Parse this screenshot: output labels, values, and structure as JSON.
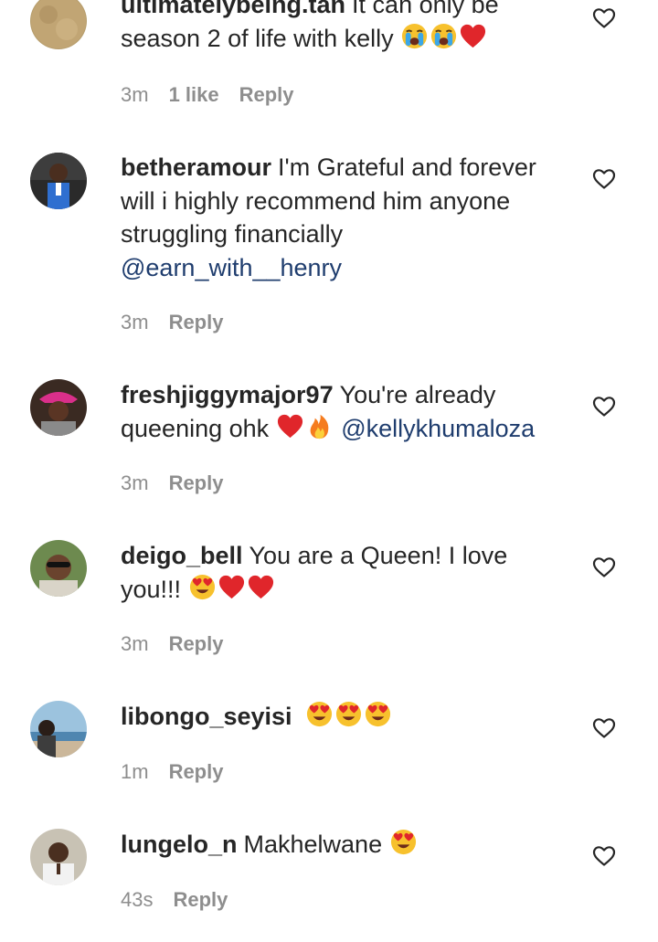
{
  "comments": [
    {
      "username": "ultimatelybeing.tan",
      "text": "It can only be season 2 of life with kelly",
      "emojis": [
        "crying-face",
        "crying-face",
        "red-heart"
      ],
      "time": "3m",
      "likes": "1 like",
      "reply": "Reply"
    },
    {
      "username": "betheramour",
      "text": "I'm Grateful and forever will i highly recommend him anyone struggling financially",
      "mention": "@earn_with__henry",
      "time": "3m",
      "reply": "Reply"
    },
    {
      "username": "freshjiggymajor97",
      "text": "You're already queening ohk",
      "emojis": [
        "red-heart",
        "fire"
      ],
      "mention": "@kellykhumaloza",
      "time": "3m",
      "reply": "Reply"
    },
    {
      "username": "deigo_bell",
      "text": "You are a Queen! I love you!!!",
      "emojis": [
        "heart-eyes-face",
        "red-heart",
        "red-heart"
      ],
      "time": "3m",
      "reply": "Reply"
    },
    {
      "username": "libongo_seyisi",
      "text": "",
      "emojis": [
        "heart-eyes-face",
        "heart-eyes-face",
        "heart-eyes-face"
      ],
      "time": "1m",
      "reply": "Reply"
    },
    {
      "username": "lungelo_n",
      "text": "Makhelwane",
      "emojis": [
        "heart-eyes-face"
      ],
      "time": "43s",
      "reply": "Reply"
    }
  ],
  "colors": {
    "text": "#262626",
    "meta": "#8e8e8e",
    "mention": "#1f3d6e",
    "heart_red": "#e0262b"
  }
}
